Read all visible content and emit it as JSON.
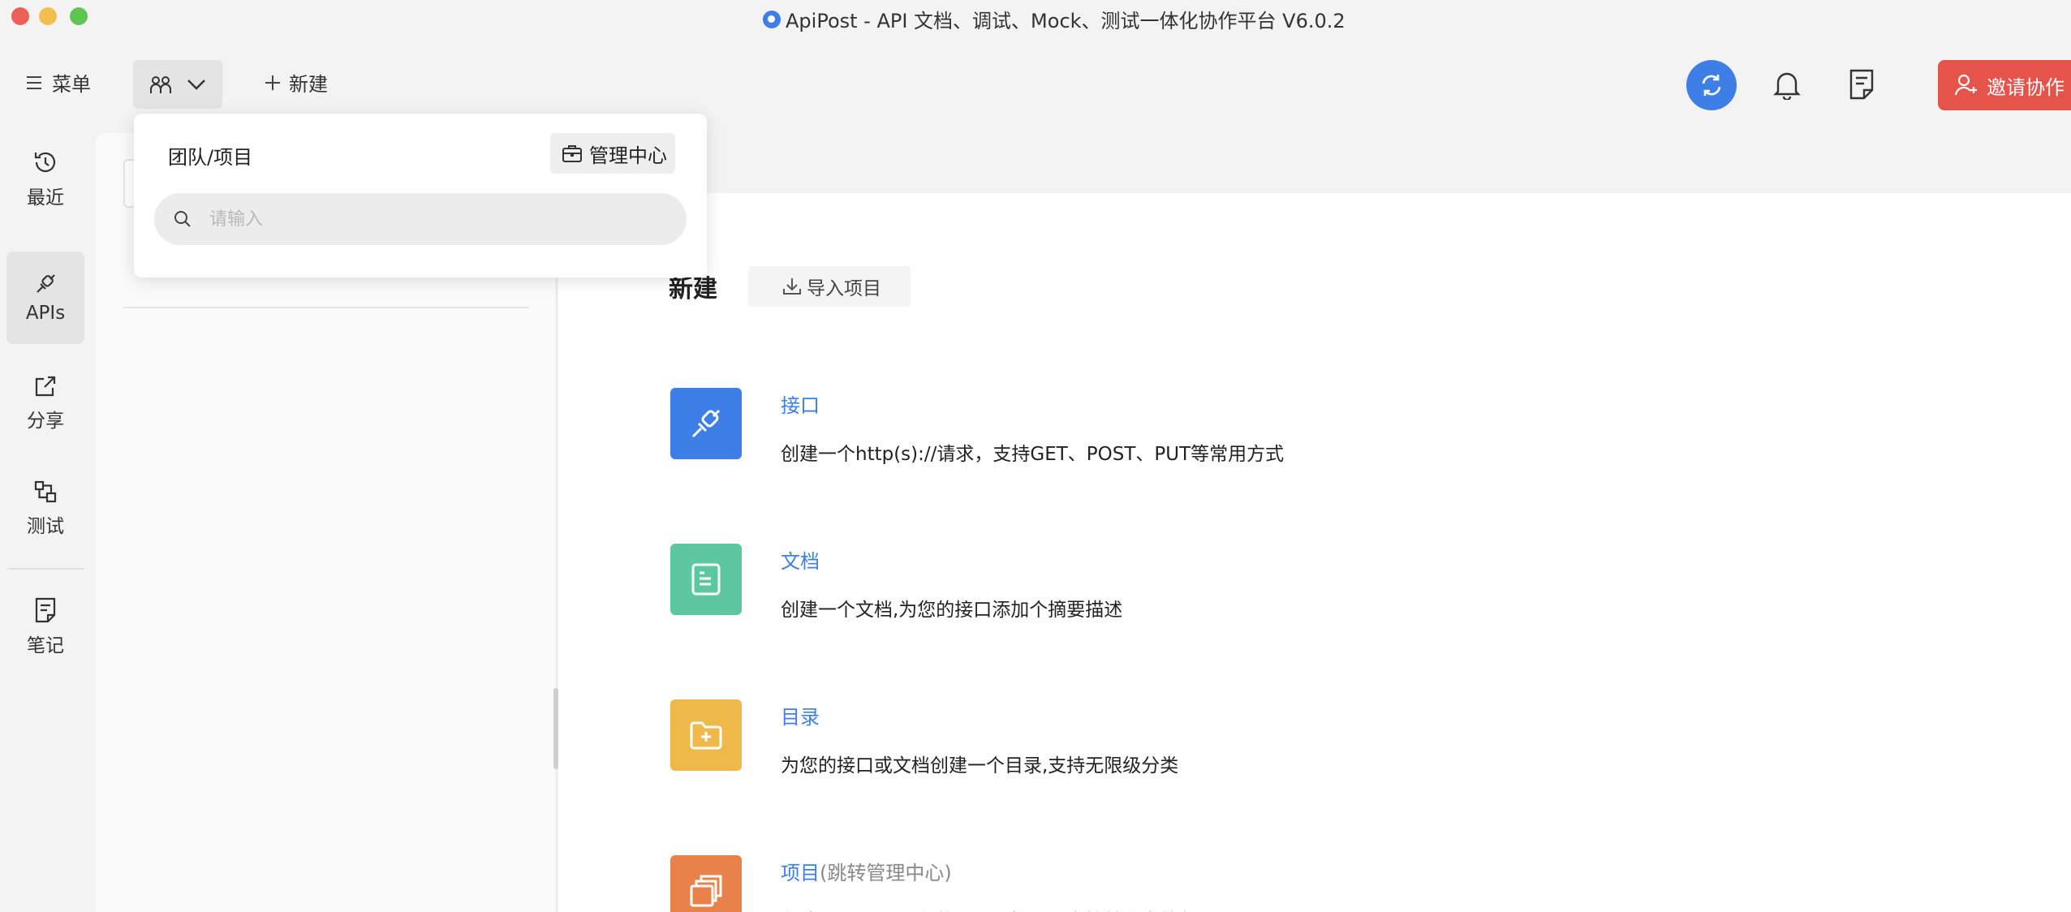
{
  "window": {
    "title": "ApiPost - API 文档、调试、Mock、测试一体化协作平台 V6.0.2",
    "app_icon": "apipost-logo-icon"
  },
  "toolbar": {
    "menu_label": "菜单",
    "menu_icon": "menu-icon",
    "team_icon": "team-icon",
    "team_chevron_icon": "chevron-down-icon",
    "new_label": "新建",
    "new_icon": "plus-icon",
    "sync_icon": "sync-icon",
    "bell_icon": "bell-icon",
    "notes_icon": "notes-icon",
    "invite_label": "邀请协作",
    "invite_icon": "user-add-icon",
    "colors": {
      "accent": "#3d7fe6",
      "invite": "#e5534b"
    }
  },
  "rail": {
    "items": [
      {
        "label": "最近",
        "icon": "history-icon",
        "active": false
      },
      {
        "label": "APIs",
        "icon": "plug-icon",
        "active": true
      },
      {
        "label": "分享",
        "icon": "share-icon",
        "active": false
      },
      {
        "label": "测试",
        "icon": "test-icon",
        "active": false
      },
      {
        "label": "笔记",
        "icon": "note-icon",
        "active": false
      }
    ]
  },
  "popover": {
    "title": "团队/项目",
    "manage_label": "管理中心",
    "manage_icon": "briefcase-icon",
    "search_placeholder": "请输入",
    "search_value": ""
  },
  "main": {
    "title": "新建",
    "import_label": "导入项目",
    "import_icon": "download-icon",
    "items": [
      {
        "title": "接口",
        "subtitle": "",
        "desc": "创建一个http(s)://请求，支持GET、POST、PUT等常用方式",
        "icon": "plug-icon",
        "color": "#3d7fe6"
      },
      {
        "title": "文档",
        "subtitle": "",
        "desc": "创建一个文档,为您的接口添加个摘要描述",
        "icon": "document-icon",
        "color": "#5dc8a0"
      },
      {
        "title": "目录",
        "subtitle": "",
        "desc": "为您的接口或文档创建一个目录,支持无限级分类",
        "icon": "folder-add-icon",
        "color": "#efb84a"
      },
      {
        "title": "项目",
        "subtitle": "(跳转管理中心)",
        "desc": "创建一个项目,所有的目录、接口、文档就有它的归属了",
        "icon": "projects-icon",
        "color": "#e8814a"
      }
    ]
  }
}
